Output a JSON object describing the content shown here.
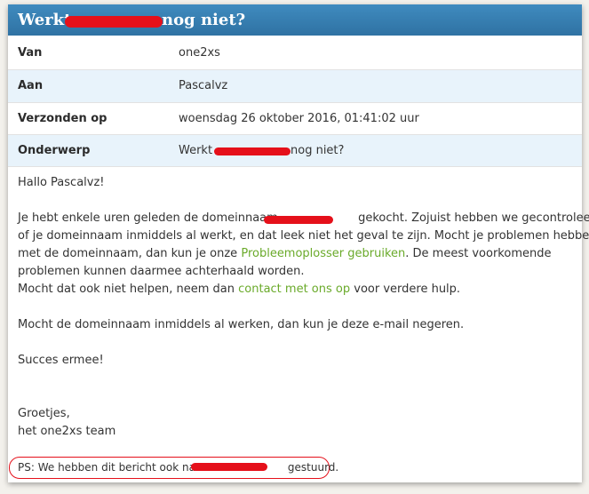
{
  "header": {
    "title_prefix": "Werkt",
    "title_suffix": "nog niet?"
  },
  "fields": [
    {
      "label": "Van",
      "value": "one2xs"
    },
    {
      "label": "Aan",
      "value": "Pascalvz"
    },
    {
      "label": "Verzonden op",
      "value": "woensdag 26 oktober 2016, 01:41:02 uur"
    },
    {
      "label": "Onderwerp",
      "value_prefix": "Werkt",
      "value_suffix": "nog niet?"
    }
  ],
  "message": {
    "greeting": "Hallo Pascalvz!",
    "p1_a": "Je hebt enkele uren geleden de domeinnaam",
    "p1_b": "gekocht. Zojuist hebben we gecontroleerd",
    "p1_c": "of je domeinnaam inmiddels al werkt, en dat leek niet het geval te zijn. Mocht je problemen hebben",
    "p1_d": "met de domeinnaam, dan kun je onze",
    "p1_link": "Probleemoplosser gebruiken",
    "p1_e": ". De meest voorkomende",
    "p1_f": "problemen kunnen daarmee achterhaald worden.",
    "p2_a": "Mocht dat ook niet helpen, neem dan",
    "p2_link": "contact met ons op",
    "p2_b": "voor verdere hulp.",
    "p3": "Mocht de domeinnaam inmiddels al werken, dan kun je deze e-mail negeren.",
    "p4": "Succes ermee!",
    "sign1": "Groetjes,",
    "sign2": "het one2xs team"
  },
  "ps": {
    "prefix": "PS: We hebben dit bericht ook naar",
    "suffix": "gestuurd."
  },
  "colors": {
    "header_bg": "#3278aa",
    "link": "#6aaa2a",
    "redaction": "#e5101a",
    "row_alt": "#e8f3fb"
  }
}
